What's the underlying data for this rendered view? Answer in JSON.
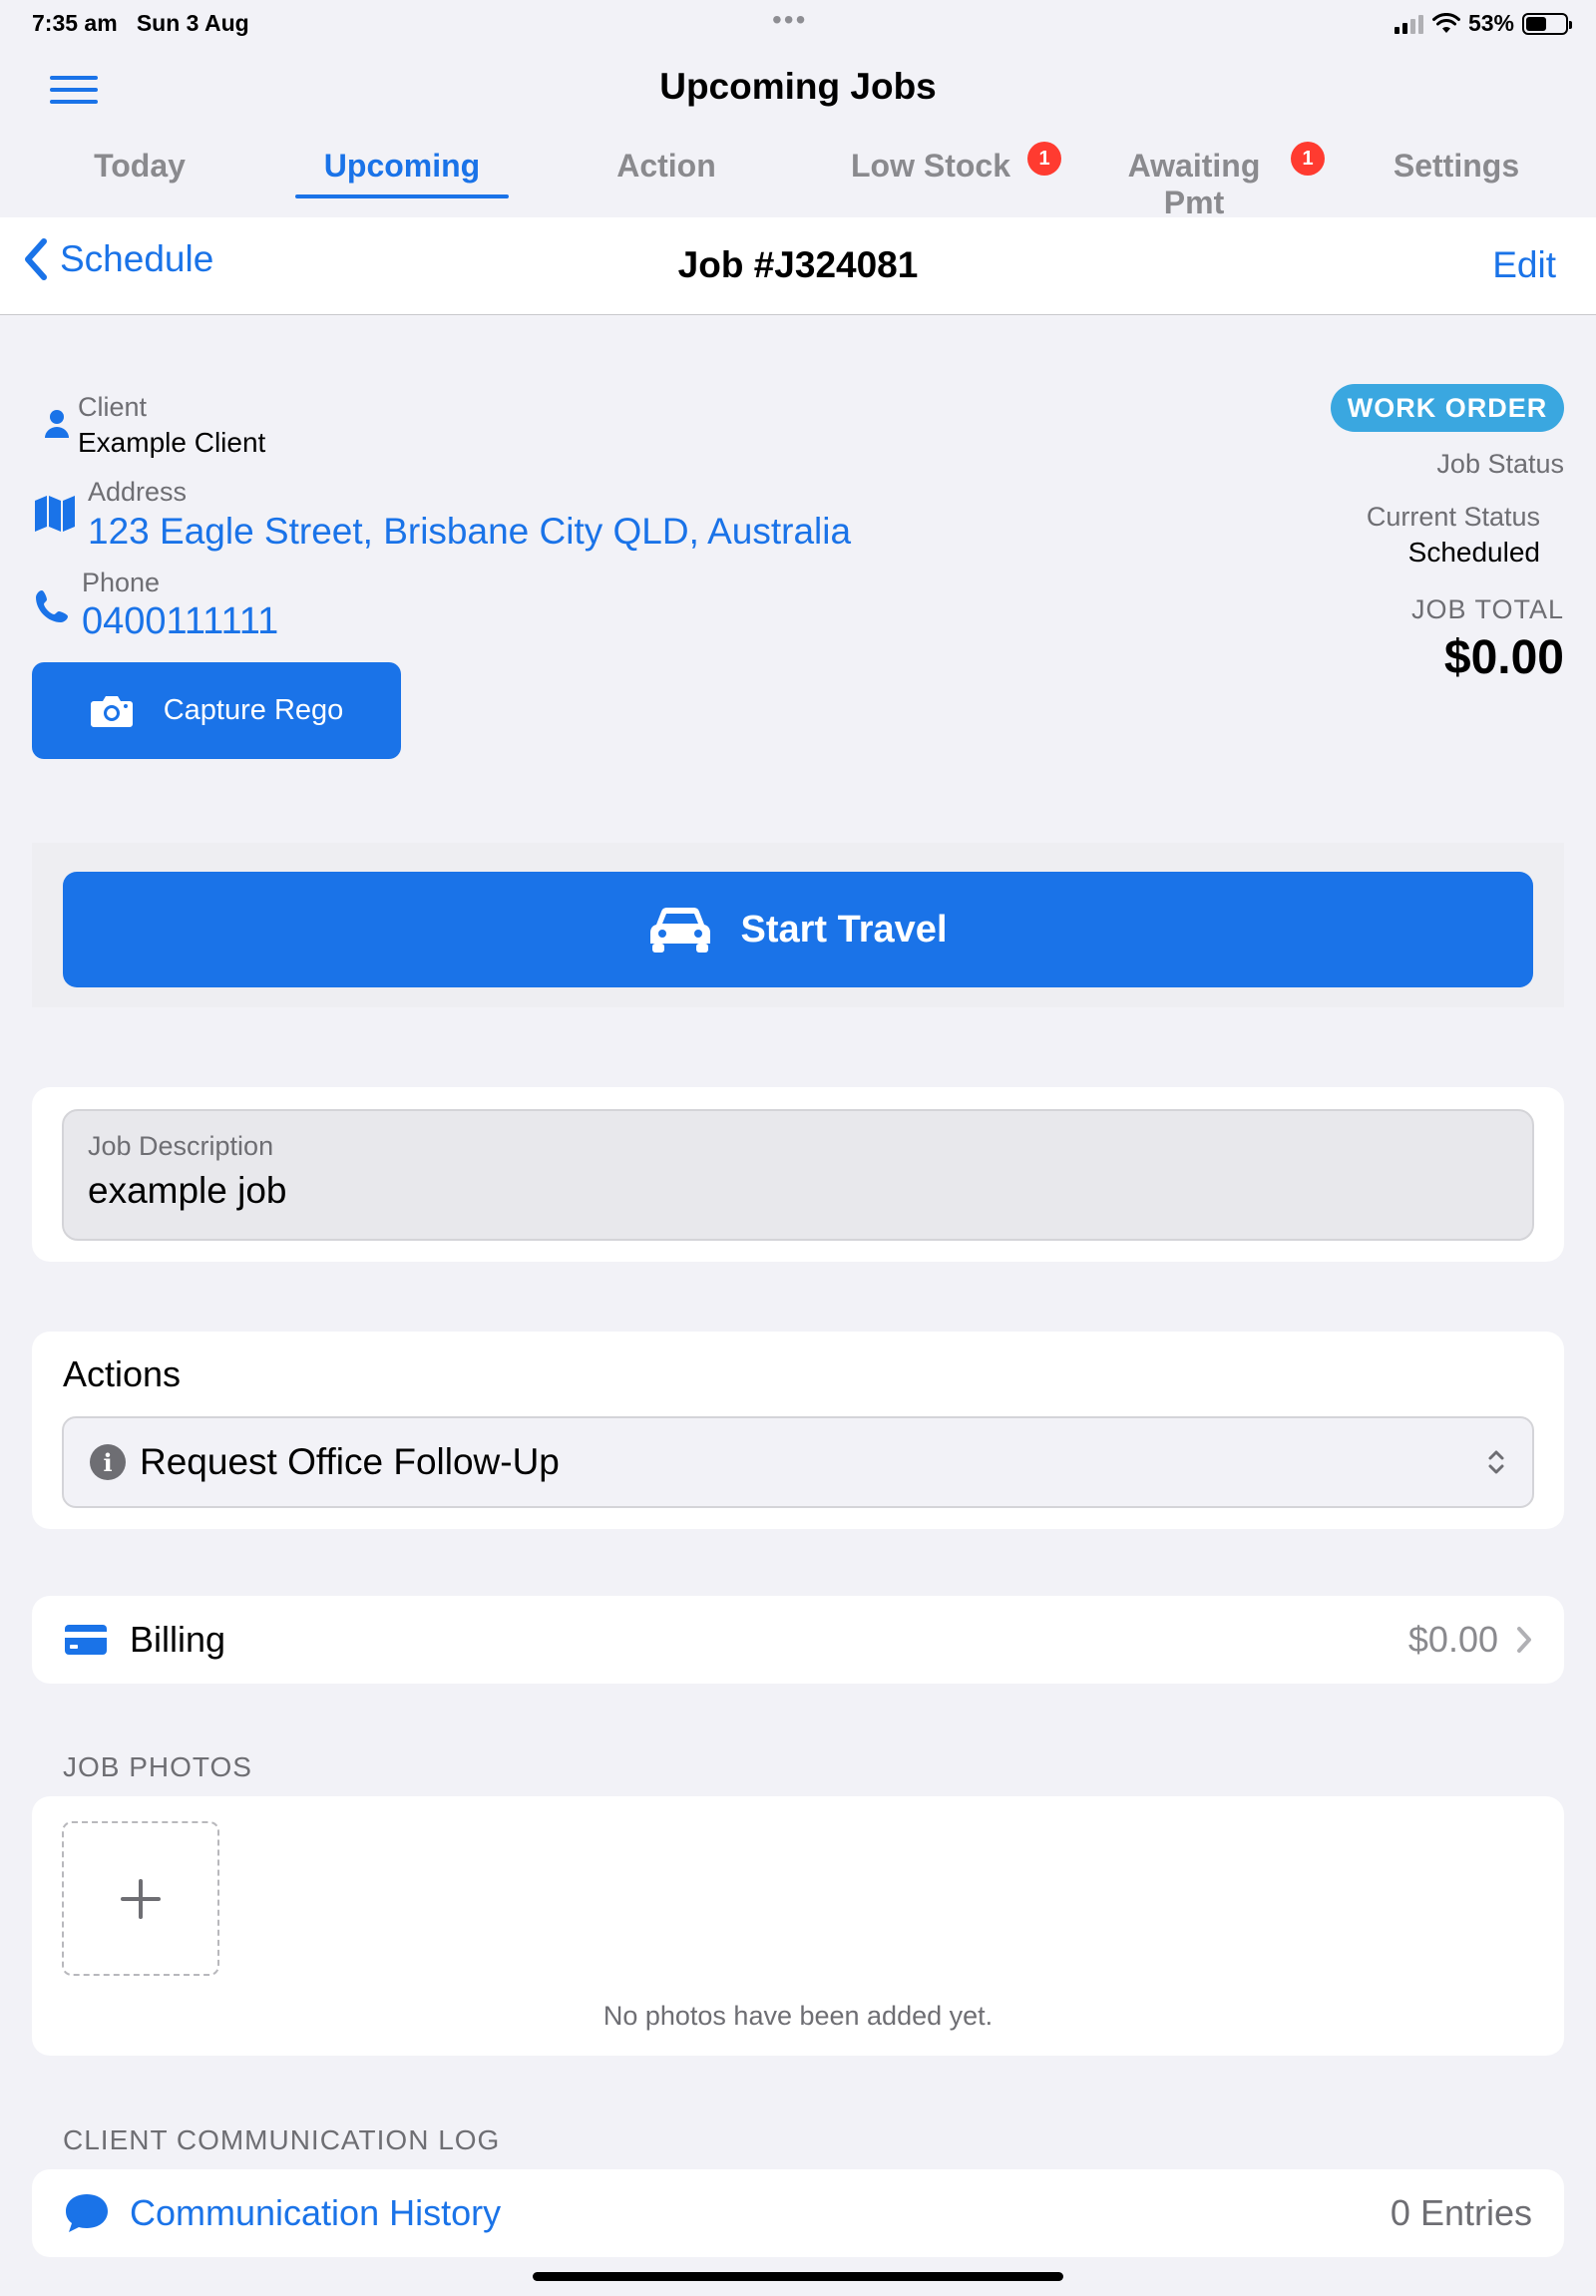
{
  "status_bar": {
    "time": "7:35 am",
    "date": "Sun 3 Aug",
    "battery": "53%",
    "battery_level": 0.53
  },
  "app": {
    "title": "Upcoming Jobs"
  },
  "tabs": [
    {
      "label": "Today",
      "active": false
    },
    {
      "label": "Upcoming",
      "active": true
    },
    {
      "label": "Action",
      "active": false
    },
    {
      "label": "Low Stock",
      "active": false,
      "badge": "1"
    },
    {
      "label": "Awaiting Pmt",
      "active": false,
      "badge": "1"
    },
    {
      "label": "Settings",
      "active": false
    }
  ],
  "nav": {
    "back_label": "Schedule",
    "title": "Job #J324081",
    "edit_label": "Edit"
  },
  "job": {
    "client_label": "Client",
    "client_value": "Example Client",
    "address_label": "Address",
    "address_value": "123 Eagle Street, Brisbane City QLD, Australia",
    "phone_label": "Phone",
    "phone_value": "0400111111",
    "capture_label": "Capture Rego",
    "work_order_badge": "WORK ORDER",
    "job_status_label": "Job Status",
    "current_status_label": "Current Status",
    "current_status_value": "Scheduled",
    "job_total_label": "JOB TOTAL",
    "job_total_value": "$0.00"
  },
  "travel": {
    "label": "Start Travel"
  },
  "description": {
    "label": "Job Description",
    "value": "example job"
  },
  "actions": {
    "title": "Actions",
    "selected": "Request Office Follow-Up"
  },
  "billing": {
    "label": "Billing",
    "amount": "$0.00"
  },
  "photos": {
    "header": "JOB PHOTOS",
    "empty_text": "No photos have been added yet."
  },
  "communication": {
    "header": "CLIENT COMMUNICATION LOG",
    "label": "Communication History",
    "count": "0 Entries"
  },
  "colors": {
    "accent": "#1a73e8",
    "badge": "#ff3b30",
    "work_order": "#3aa7e0",
    "background": "#f2f2f7"
  }
}
